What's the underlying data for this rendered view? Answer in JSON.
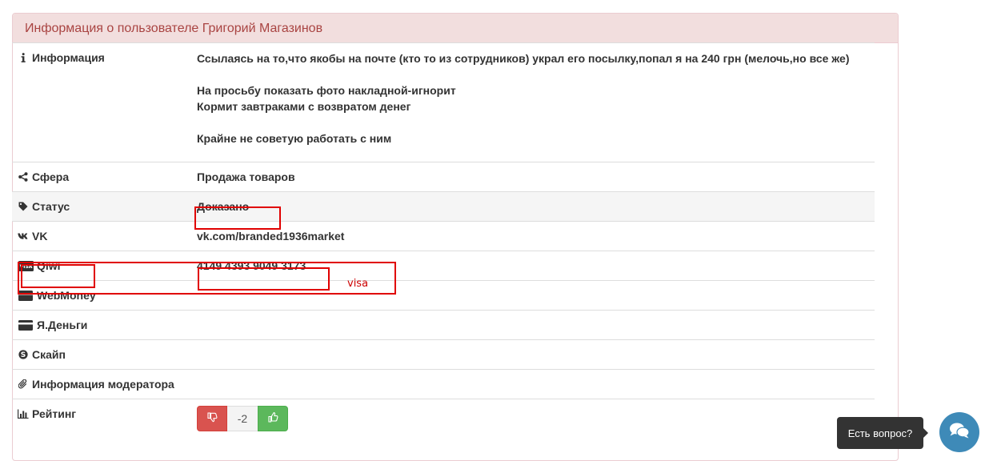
{
  "panel": {
    "title": "Информация о пользователе Григорий Магазинов"
  },
  "rows": {
    "info": {
      "label": "Информация",
      "icon": "info-icon",
      "lines": [
        "Ссылаясь на то,что якобы на почте (кто то из сотрудников) украл его посылку,попал я на 240 грн (мелочь,но все же)",
        "",
        "На просьбу показать фото накладной-игнорит",
        "Кормит завтраками с возвратом денег",
        "",
        "Крайне не советую работать с ним"
      ]
    },
    "sphere": {
      "label": "Сфера",
      "icon": "share-icon",
      "value": "Продажа товаров"
    },
    "status": {
      "label": "Статус",
      "icon": "tag-icon",
      "value": "Доказано"
    },
    "vk": {
      "label": "VK",
      "icon": "vk-icon",
      "value": "vk.com/branded1936market"
    },
    "qiwi": {
      "label": "Qiwi",
      "icon": "visa-card-icon",
      "value": "4149 4393 9049 3173"
    },
    "webmoney": {
      "label": "WebMoney",
      "icon": "credit-card-icon",
      "value": ""
    },
    "yandex": {
      "label": "Я.Деньги",
      "icon": "credit-card-icon",
      "value": ""
    },
    "skype": {
      "label": "Скайп",
      "icon": "skype-icon",
      "value": ""
    },
    "moderator": {
      "label": "Информация модератора",
      "icon": "paperclip-icon",
      "value": ""
    },
    "rating": {
      "label": "Рейтинг",
      "icon": "bar-chart-icon",
      "count": "-2",
      "down_icon": "thumbs-down-icon",
      "up_icon": "thumbs-up-icon"
    }
  },
  "annotation": {
    "note": "visa",
    "color": "#e00000"
  },
  "chat": {
    "tooltip": "Есть вопрос?",
    "icon": "chat-bubbles-icon"
  },
  "colors": {
    "heading_bg": "#f2dede",
    "heading_text": "#a94442",
    "danger": "#d9534f",
    "success": "#5cb85c",
    "chat": "#3e8ab8"
  }
}
